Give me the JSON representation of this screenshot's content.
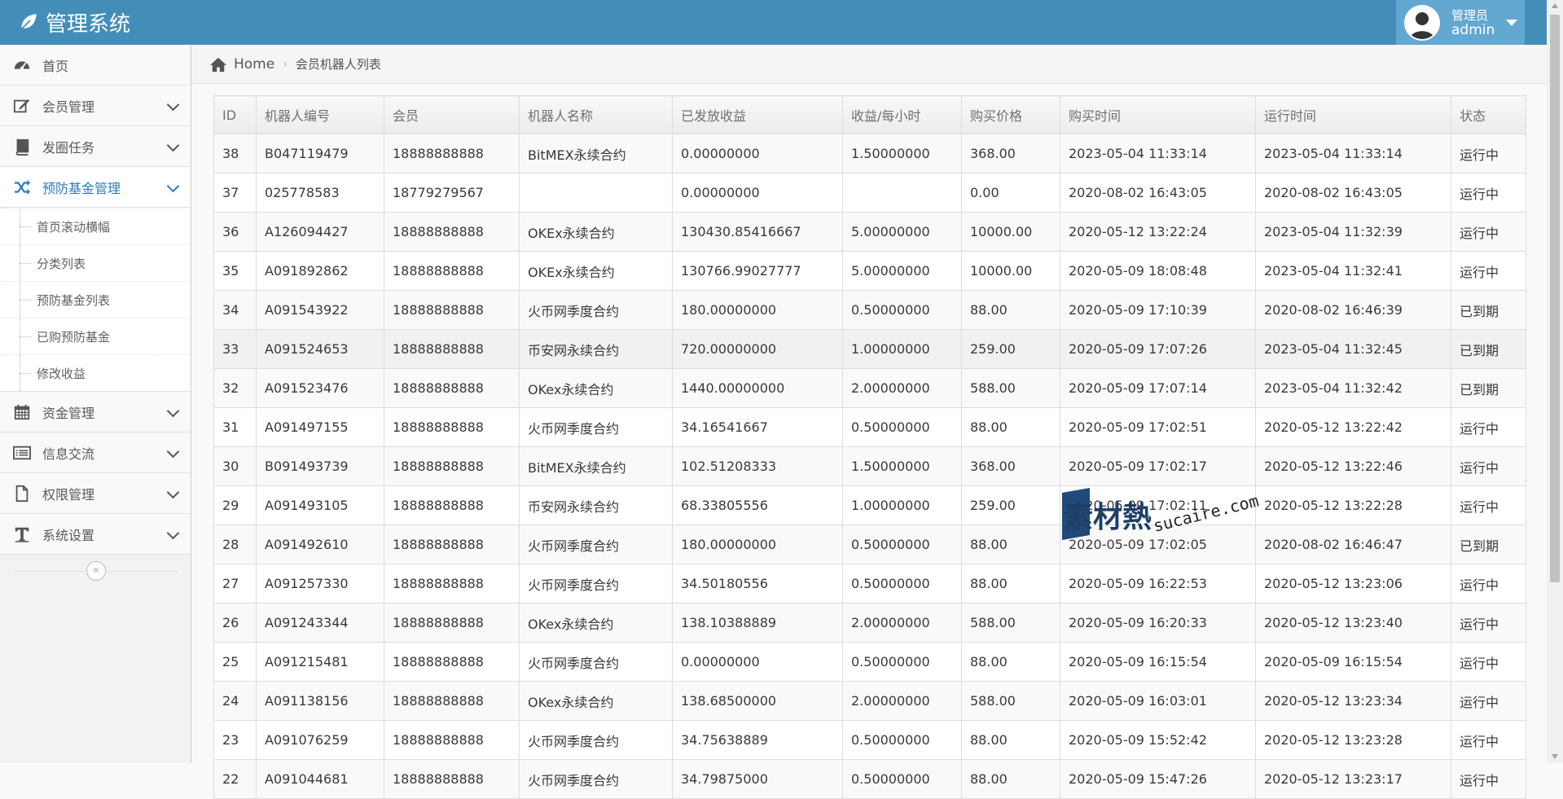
{
  "header": {
    "brand": "管理系统",
    "user_role": "管理员",
    "user_name": "admin"
  },
  "colors": {
    "header_bg": "#438eb9",
    "user_bg": "#62a8d1",
    "active_nav": "#2b7dbc"
  },
  "sidebar": {
    "items": [
      {
        "label": "首页",
        "icon": "dashboard-icon"
      },
      {
        "label": "会员管理",
        "icon": "edit-icon"
      },
      {
        "label": "发圈任务",
        "icon": "book-icon"
      },
      {
        "label": "预防基金管理",
        "icon": "shuffle-icon"
      },
      {
        "label": "资金管理",
        "icon": "calendar-icon"
      },
      {
        "label": "信息交流",
        "icon": "list-icon"
      },
      {
        "label": "权限管理",
        "icon": "file-icon"
      },
      {
        "label": "系统设置",
        "icon": "text-icon"
      }
    ],
    "submenu": [
      "首页滚动横幅",
      "分类列表",
      "预防基金列表",
      "已购预防基金",
      "修改收益"
    ],
    "collapse_glyph": "«"
  },
  "breadcrumb": {
    "home": "Home",
    "separator": "›",
    "current": "会员机器人列表"
  },
  "table": {
    "columns": [
      "ID",
      "机器人编号",
      "会员",
      "机器人名称",
      "已发放收益",
      "收益/每小时",
      "购买价格",
      "购买时间",
      "运行时间",
      "状态"
    ],
    "rows": [
      [
        "38",
        "B047119479",
        "18888888888",
        "BitMEX永续合约",
        "0.00000000",
        "1.50000000",
        "368.00",
        "2023-05-04 11:33:14",
        "2023-05-04 11:33:14",
        "运行中"
      ],
      [
        "37",
        "025778583",
        "18779279567",
        "",
        "0.00000000",
        "",
        "0.00",
        "2020-08-02 16:43:05",
        "2020-08-02 16:43:05",
        "运行中"
      ],
      [
        "36",
        "A126094427",
        "18888888888",
        "OKEx永续合约",
        "130430.85416667",
        "5.00000000",
        "10000.00",
        "2020-05-12 13:22:24",
        "2023-05-04 11:32:39",
        "运行中"
      ],
      [
        "35",
        "A091892862",
        "18888888888",
        "OKEx永续合约",
        "130766.99027777",
        "5.00000000",
        "10000.00",
        "2020-05-09 18:08:48",
        "2023-05-04 11:32:41",
        "运行中"
      ],
      [
        "34",
        "A091543922",
        "18888888888",
        "火币网季度合约",
        "180.00000000",
        "0.50000000",
        "88.00",
        "2020-05-09 17:10:39",
        "2020-08-02 16:46:39",
        "已到期"
      ],
      [
        "33",
        "A091524653",
        "18888888888",
        "币安网永续合约",
        "720.00000000",
        "1.00000000",
        "259.00",
        "2020-05-09 17:07:26",
        "2023-05-04 11:32:45",
        "已到期"
      ],
      [
        "32",
        "A091523476",
        "18888888888",
        "OKex永续合约",
        "1440.00000000",
        "2.00000000",
        "588.00",
        "2020-05-09 17:07:14",
        "2023-05-04 11:32:42",
        "已到期"
      ],
      [
        "31",
        "A091497155",
        "18888888888",
        "火币网季度合约",
        "34.16541667",
        "0.50000000",
        "88.00",
        "2020-05-09 17:02:51",
        "2020-05-12 13:22:42",
        "运行中"
      ],
      [
        "30",
        "B091493739",
        "18888888888",
        "BitMEX永续合约",
        "102.51208333",
        "1.50000000",
        "368.00",
        "2020-05-09 17:02:17",
        "2020-05-12 13:22:46",
        "运行中"
      ],
      [
        "29",
        "A091493105",
        "18888888888",
        "币安网永续合约",
        "68.33805556",
        "1.00000000",
        "259.00",
        "2020-05-09 17:02:11",
        "2020-05-12 13:22:28",
        "运行中"
      ],
      [
        "28",
        "A091492610",
        "18888888888",
        "火币网季度合约",
        "180.00000000",
        "0.50000000",
        "88.00",
        "2020-05-09 17:02:05",
        "2020-08-02 16:46:47",
        "已到期"
      ],
      [
        "27",
        "A091257330",
        "18888888888",
        "火币网季度合约",
        "34.50180556",
        "0.50000000",
        "88.00",
        "2020-05-09 16:22:53",
        "2020-05-12 13:23:06",
        "运行中"
      ],
      [
        "26",
        "A091243344",
        "18888888888",
        "OKex永续合约",
        "138.10388889",
        "2.00000000",
        "588.00",
        "2020-05-09 16:20:33",
        "2020-05-12 13:23:40",
        "运行中"
      ],
      [
        "25",
        "A091215481",
        "18888888888",
        "火币网季度合约",
        "0.00000000",
        "0.50000000",
        "88.00",
        "2020-05-09 16:15:54",
        "2020-05-09 16:15:54",
        "运行中"
      ],
      [
        "24",
        "A091138156",
        "18888888888",
        "OKex永续合约",
        "138.68500000",
        "2.00000000",
        "588.00",
        "2020-05-09 16:03:01",
        "2020-05-12 13:23:34",
        "运行中"
      ],
      [
        "23",
        "A091076259",
        "18888888888",
        "火币网季度合约",
        "34.75638889",
        "0.50000000",
        "88.00",
        "2020-05-09 15:52:42",
        "2020-05-12 13:23:28",
        "运行中"
      ],
      [
        "22",
        "A091044681",
        "18888888888",
        "火币网季度合约",
        "34.79875000",
        "0.50000000",
        "88.00",
        "2020-05-09 15:47:26",
        "2020-05-12 13:23:17",
        "运行中"
      ]
    ],
    "highlight_row_index": 5
  },
  "watermark": {
    "main": "素材熱",
    "sub": "sucaire.com"
  }
}
